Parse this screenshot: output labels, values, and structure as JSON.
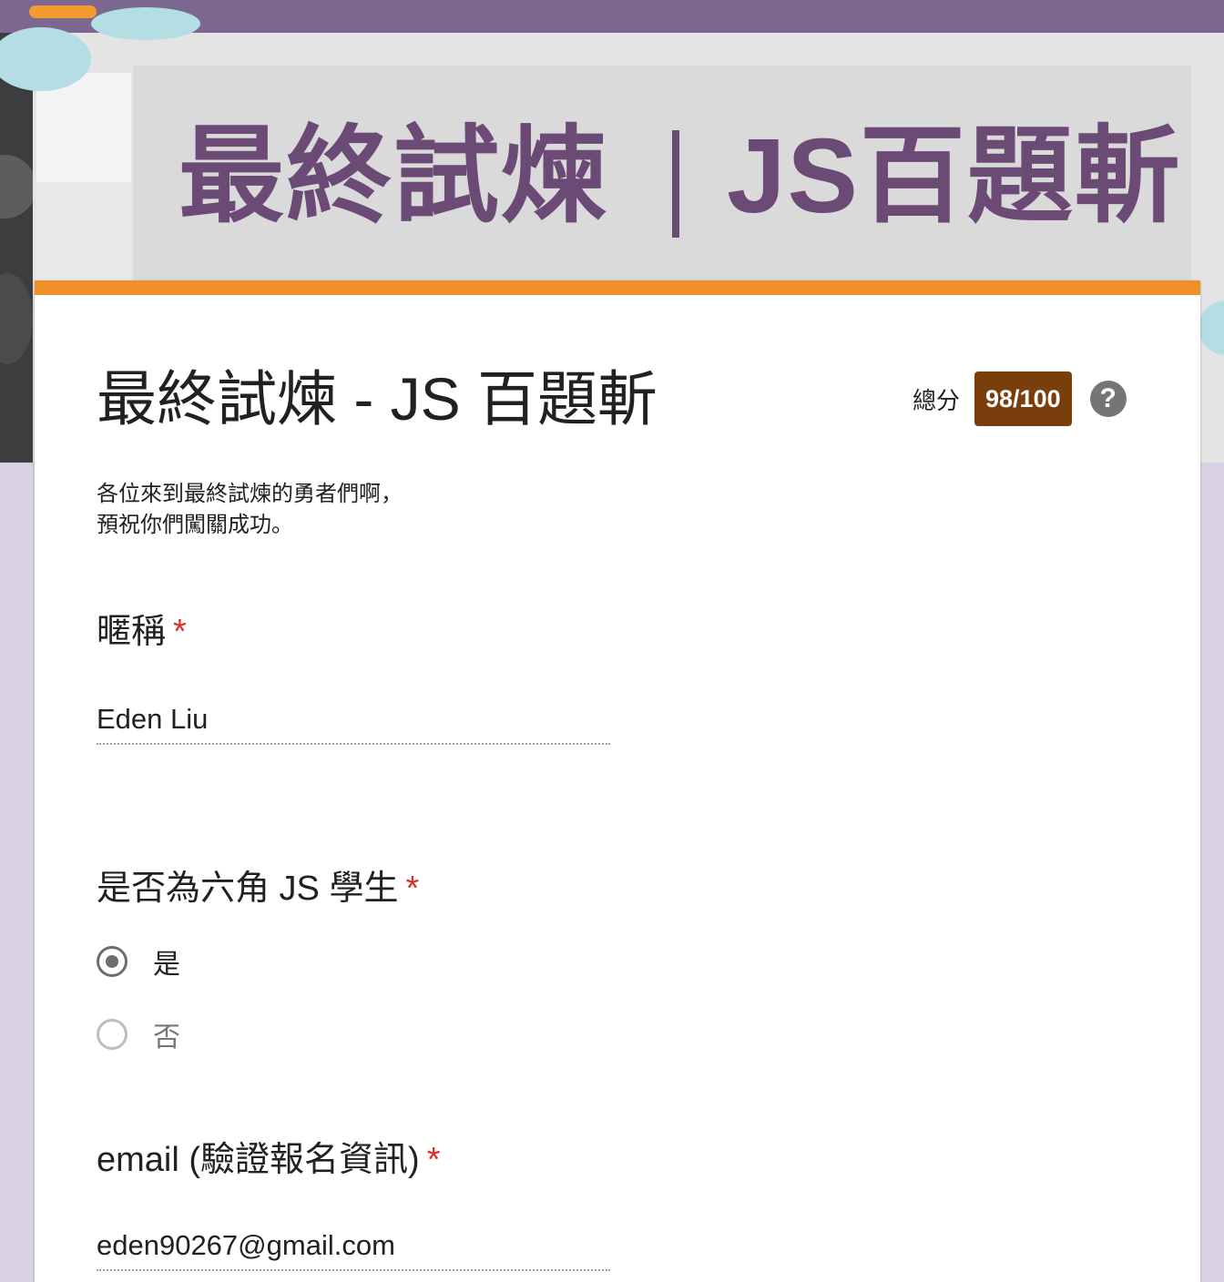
{
  "banner": {
    "title_left": "最終試煉",
    "title_right": "JS百題斬"
  },
  "form": {
    "title": "最終試煉 - JS 百題斬",
    "score_label": "總分",
    "score_value": "98/100",
    "help_symbol": "?",
    "description_line1": "各位來到最終試煉的勇者們啊，",
    "description_line2": "預祝你們闖關成功。"
  },
  "questions": [
    {
      "title": "暱稱",
      "required_mark": "*",
      "answer": "Eden Liu"
    },
    {
      "title": "是否為六角 JS 學生",
      "required_mark": "*",
      "options": [
        {
          "label": "是",
          "selected": true
        },
        {
          "label": "否",
          "selected": false
        }
      ]
    },
    {
      "title": "email (驗證報名資訊)",
      "required_mark": "*",
      "answer": "eden90267@gmail.com"
    }
  ],
  "colors": {
    "accent": "#f0902b",
    "score_badge": "#7a3e0c",
    "required": "#d93025",
    "banner_text": "#6b4a75",
    "page_background": "#d9d1e3"
  },
  "icons": {
    "help": "help-icon",
    "radio_checked": "radio-checked-icon",
    "radio_unchecked": "radio-unchecked-icon"
  }
}
